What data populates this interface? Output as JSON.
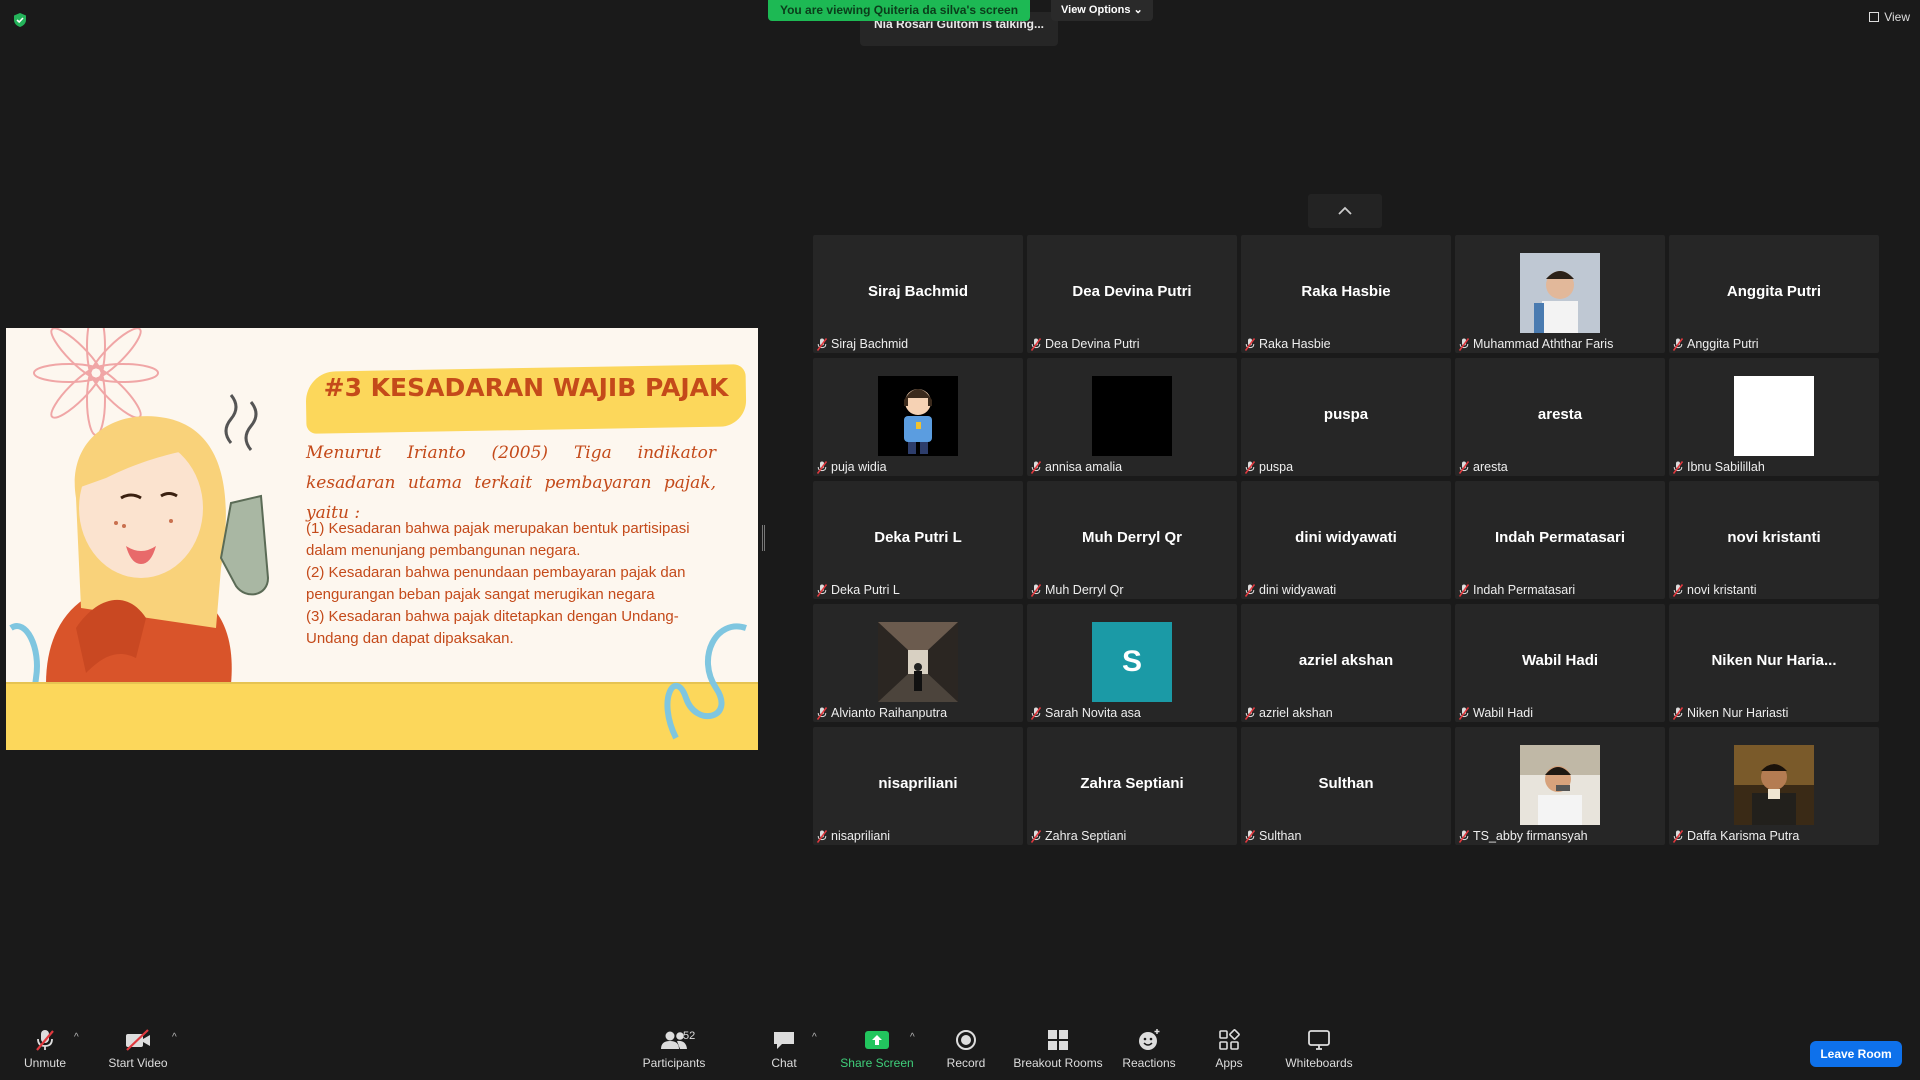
{
  "top": {
    "banner": "You are viewing Quiteria da silva's screen",
    "view_options": "View Options",
    "talking": "Nia Rosari Gultom is talking...",
    "view": "View"
  },
  "slide": {
    "title": "#3 KESADARAN WAJIB PAJAK",
    "intro": "Menurut Irianto (2005) Tiga indikator kesadaran utama terkait pembayaran pajak, yaitu :",
    "body": "(1) Kesadaran bahwa pajak merupakan bentuk partisipasi dalam menunjang pembangunan negara.\n (2) Kesadaran bahwa penundaan pembayaran pajak dan pengurangan beban pajak sangat merugikan negara\n(3) Kesadaran bahwa pajak ditetapkan dengan Undang-Undang dan dapat dipaksakan."
  },
  "participants": [
    {
      "center": "Siraj Bachmid",
      "name": "Siraj Bachmid"
    },
    {
      "center": "Dea Devina Putri",
      "name": "Dea Devina Putri"
    },
    {
      "center": "Raka Hasbie",
      "name": "Raka Hasbie"
    },
    {
      "center": "",
      "name": "Muhammad Aththar Faris",
      "avatar": "child-photo"
    },
    {
      "center": "Anggita Putri",
      "name": "Anggita Putri"
    },
    {
      "center": "",
      "name": "puja widia",
      "avatar": "cartoon-girl"
    },
    {
      "center": "",
      "name": "annisa amalia",
      "avatar": "black-square"
    },
    {
      "center": "puspa",
      "name": "puspa"
    },
    {
      "center": "aresta",
      "name": "aresta"
    },
    {
      "center": "",
      "name": "Ibnu Sabilillah",
      "avatar": "white-square"
    },
    {
      "center": "Deka Putri L",
      "name": "Deka Putri L"
    },
    {
      "center": "Muh Derryl Qr",
      "name": "Muh Derryl Qr"
    },
    {
      "center": "dini widyawati",
      "name": "dini widyawati"
    },
    {
      "center": "Indah Permatasari",
      "name": "Indah Permatasari"
    },
    {
      "center": "novi kristanti",
      "name": "novi kristanti"
    },
    {
      "center": "",
      "name": "Alvianto Raihanputra",
      "avatar": "corridor-photo"
    },
    {
      "center": "",
      "name": "Sarah Novita asa",
      "avatar": "initial-S",
      "initial": "S"
    },
    {
      "center": "azriel akshan",
      "name": "azriel akshan"
    },
    {
      "center": "Wabil Hadi",
      "name": "Wabil Hadi"
    },
    {
      "center": "Niken  Nur  Haria...",
      "name": "Niken Nur Hariasti"
    },
    {
      "center": "nisapriliani",
      "name": "nisapriliani"
    },
    {
      "center": "Zahra Septiani",
      "name": "Zahra Septiani"
    },
    {
      "center": "Sulthan",
      "name": "Sulthan"
    },
    {
      "center": "",
      "name": "TS_abby firmansyah",
      "avatar": "person-photo"
    },
    {
      "center": "",
      "name": "Daffa Karisma Putra",
      "avatar": "man-photo"
    }
  ],
  "toolbar": {
    "unmute": "Unmute",
    "start_video": "Start Video",
    "participants": "Participants",
    "participants_count": "52",
    "chat": "Chat",
    "share_screen": "Share Screen",
    "record": "Record",
    "breakout_rooms": "Breakout Rooms",
    "reactions": "Reactions",
    "apps": "Apps",
    "whiteboards": "Whiteboards",
    "leave_room": "Leave Room"
  },
  "colors": {
    "accent_green": "#1db954",
    "leave_blue": "#0e71eb",
    "slide_yellow": "#fcd75b",
    "slide_text": "#c44a1a"
  }
}
